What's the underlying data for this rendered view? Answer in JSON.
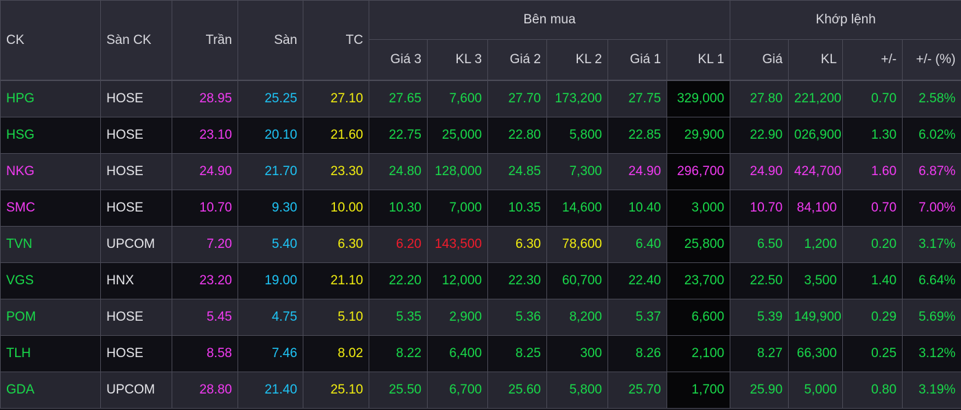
{
  "header": {
    "ck": "CK",
    "san_ck": "Sàn CK",
    "tran": "Trần",
    "san": "Sàn",
    "tc": "TC",
    "ben_mua": "Bên mua",
    "khop_lenh": "Khớp lệnh",
    "gia3": "Giá 3",
    "kl3": "KL 3",
    "gia2": "Giá 2",
    "kl2": "KL 2",
    "gia1": "Giá 1",
    "kl1": "KL 1",
    "gia": "Giá",
    "kl": "KL",
    "change": "+/-",
    "change_pct": "+/- (%)"
  },
  "colors": {
    "green": "#19d94a",
    "purple": "#f23bf2",
    "cyan": "#1ec4f5",
    "yellow": "#f2ee10",
    "red": "#ef1c2c",
    "white": "#e6e6ea"
  },
  "rows": [
    {
      "sym": "HPG",
      "exch": "HOSE",
      "tran": "28.95",
      "san": "25.25",
      "tc": "27.10",
      "gia3": "27.65",
      "kl3": "7,600",
      "gia2": "27.70",
      "kl2": "173,200",
      "gia1": "27.75",
      "kl1": "329,000",
      "gia": "27.80",
      "kl": "221,200",
      "chg": "0.70",
      "pct": "2.58%"
    },
    {
      "sym": "HSG",
      "exch": "HOSE",
      "tran": "23.10",
      "san": "20.10",
      "tc": "21.60",
      "gia3": "22.75",
      "kl3": "25,000",
      "gia2": "22.80",
      "kl2": "5,800",
      "gia1": "22.85",
      "kl1": "29,900",
      "gia": "22.90",
      "kl": "026,900",
      "chg": "1.30",
      "pct": "6.02%"
    },
    {
      "sym": "NKG",
      "exch": "HOSE",
      "tran": "24.90",
      "san": "21.70",
      "tc": "23.30",
      "gia3": "24.80",
      "kl3": "128,000",
      "gia2": "24.85",
      "kl2": "7,300",
      "gia1": "24.90",
      "kl1": "296,700",
      "gia": "24.90",
      "kl": "424,700",
      "chg": "1.60",
      "pct": "6.87%"
    },
    {
      "sym": "SMC",
      "exch": "HOSE",
      "tran": "10.70",
      "san": "9.30",
      "tc": "10.00",
      "gia3": "10.30",
      "kl3": "7,000",
      "gia2": "10.35",
      "kl2": "14,600",
      "gia1": "10.40",
      "kl1": "3,000",
      "gia": "10.70",
      "kl": "84,100",
      "chg": "0.70",
      "pct": "7.00%"
    },
    {
      "sym": "TVN",
      "exch": "UPCOM",
      "tran": "7.20",
      "san": "5.40",
      "tc": "6.30",
      "gia3": "6.20",
      "kl3": "143,500",
      "gia2": "6.30",
      "kl2": "78,600",
      "gia1": "6.40",
      "kl1": "25,800",
      "gia": "6.50",
      "kl": "1,200",
      "chg": "0.20",
      "pct": "3.17%"
    },
    {
      "sym": "VGS",
      "exch": "HNX",
      "tran": "23.20",
      "san": "19.00",
      "tc": "21.10",
      "gia3": "22.20",
      "kl3": "12,000",
      "gia2": "22.30",
      "kl2": "60,700",
      "gia1": "22.40",
      "kl1": "23,700",
      "gia": "22.50",
      "kl": "3,500",
      "chg": "1.40",
      "pct": "6.64%"
    },
    {
      "sym": "POM",
      "exch": "HOSE",
      "tran": "5.45",
      "san": "4.75",
      "tc": "5.10",
      "gia3": "5.35",
      "kl3": "2,900",
      "gia2": "5.36",
      "kl2": "8,200",
      "gia1": "5.37",
      "kl1": "6,600",
      "gia": "5.39",
      "kl": "149,900",
      "chg": "0.29",
      "pct": "5.69%"
    },
    {
      "sym": "TLH",
      "exch": "HOSE",
      "tran": "8.58",
      "san": "7.46",
      "tc": "8.02",
      "gia3": "8.22",
      "kl3": "6,400",
      "gia2": "8.25",
      "kl2": "300",
      "gia1": "8.26",
      "kl1": "2,100",
      "gia": "8.27",
      "kl": "66,300",
      "chg": "0.25",
      "pct": "3.12%"
    },
    {
      "sym": "GDA",
      "exch": "UPCOM",
      "tran": "28.80",
      "san": "21.40",
      "tc": "25.10",
      "gia3": "25.50",
      "kl3": "6,700",
      "gia2": "25.60",
      "kl2": "5,800",
      "gia1": "25.70",
      "kl1": "1,700",
      "gia": "25.90",
      "kl": "5,000",
      "chg": "0.80",
      "pct": "3.19%"
    }
  ]
}
